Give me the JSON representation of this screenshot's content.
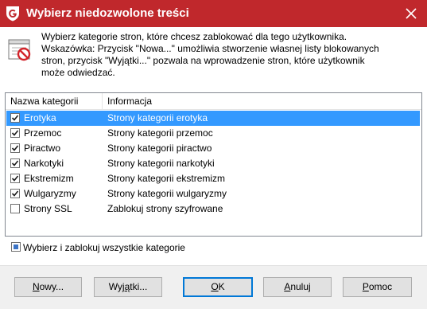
{
  "window": {
    "title": "Wybierz niedozwolone treści",
    "brand_color": "#c0282c"
  },
  "info": {
    "line1": "Wybierz kategorie stron, które chcesz zablokować dla tego użytkownika.",
    "line2": "Wskazówka: Przycisk \"Nowa...\" umożliwia stworzenie własnej listy blokowanych",
    "line3": "stron, przycisk \"Wyjątki...\" pozwala na wprowadzenie stron, które użytkownik",
    "line4": "może odwiedzać."
  },
  "list": {
    "headers": {
      "name": "Nazwa kategorii",
      "info": "Informacja"
    },
    "rows": [
      {
        "name": "Erotyka",
        "info": "Strony kategorii erotyka",
        "checked": true,
        "selected": true
      },
      {
        "name": "Przemoc",
        "info": "Strony kategorii przemoc",
        "checked": true,
        "selected": false
      },
      {
        "name": "Piractwo",
        "info": "Strony kategorii piractwo",
        "checked": true,
        "selected": false
      },
      {
        "name": "Narkotyki",
        "info": "Strony kategorii narkotyki",
        "checked": true,
        "selected": false
      },
      {
        "name": "Ekstremizm",
        "info": "Strony kategorii ekstremizm",
        "checked": true,
        "selected": false
      },
      {
        "name": "Wulgaryzmy",
        "info": "Strony kategorii wulgaryzmy",
        "checked": true,
        "selected": false
      },
      {
        "name": "Strony SSL",
        "info": "Zablokuj strony szyfrowane",
        "checked": false,
        "selected": false
      }
    ],
    "selection_color": "#3399ff"
  },
  "select_all": {
    "label": "Wybierz i zablokuj wszystkie kategorie",
    "state": "partial"
  },
  "buttons": {
    "new": {
      "mnemonic": "N",
      "rest": "owy..."
    },
    "exceptions": {
      "prefix": "Wyj",
      "mnemonic": "ą",
      "rest": "tki..."
    },
    "ok": {
      "mnemonic": "O",
      "rest": "K"
    },
    "cancel": {
      "mnemonic": "A",
      "rest": "nuluj"
    },
    "help": {
      "mnemonic": "P",
      "rest": "omoc"
    }
  },
  "icons": {
    "title_logo": "gdata-shield-icon",
    "close": "close-icon",
    "info": "blocked-page-icon",
    "checkbox": "checkmark-icon"
  }
}
